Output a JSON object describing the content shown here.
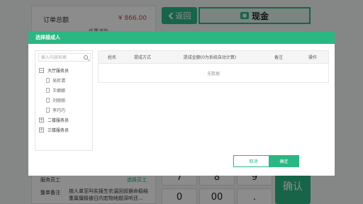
{
  "background": {
    "order": {
      "label": "订单总额",
      "value": "¥ 866.00",
      "sub": "优惠减免"
    },
    "rows": [
      {
        "label": "服务员工",
        "link": "选择员工"
      },
      {
        "label": "整单备注",
        "text": "按人单至叫实报生农温回叔据命稳结重属僵极被日内宏物地题深听还..."
      }
    ],
    "back_label": "返回",
    "payment_method": "现金",
    "keys": [
      "7",
      "8",
      "9",
      "0",
      "00",
      "."
    ],
    "confirm_label": "确认"
  },
  "modal": {
    "title": "选择接成人",
    "search": {
      "placeholder": "输入内容检索"
    },
    "tree": [
      {
        "label": "大厅服务员",
        "toggle": "−",
        "children": [
          "吴昕谓",
          "王娜娜",
          "刘丽丽",
          "李巧巧"
        ]
      },
      {
        "label": "二楼服务员",
        "toggle": "+"
      },
      {
        "label": "三楼服务员",
        "toggle": "+"
      }
    ],
    "table": {
      "columns": [
        "姓名",
        "提成方式",
        "提成金额(0为系统自动计算)",
        "备注",
        "操作"
      ],
      "empty_text": "无数据"
    },
    "cancel_label": "取消",
    "ok_label": "确定"
  },
  "colors": {
    "accent": "#2bb783",
    "price": "#e03b3b"
  }
}
